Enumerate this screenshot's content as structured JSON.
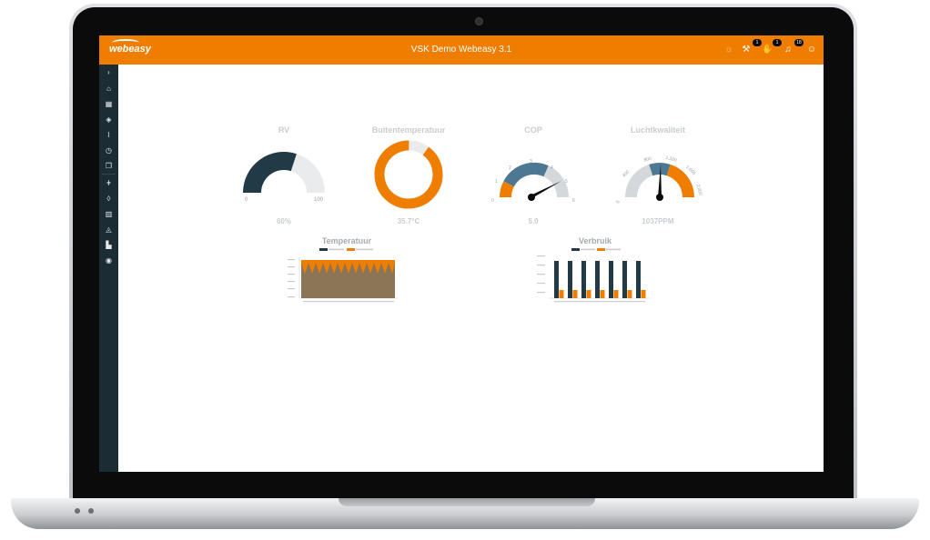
{
  "colors": {
    "accent": "#ef7d00",
    "dark": "#213a46",
    "sidebar": "#1b2c35",
    "track": "#e9ebec",
    "gaugeBlue": "#4d7894"
  },
  "header": {
    "logo": "webeasy",
    "title": "VSK Demo Webeasy 3.1",
    "icons": [
      {
        "name": "sun-icon",
        "badge": ""
      },
      {
        "name": "wrench-icon",
        "badge": "1"
      },
      {
        "name": "hand-icon",
        "badge": "1"
      },
      {
        "name": "bell-icon",
        "badge": "18"
      },
      {
        "name": "user-icon",
        "badge": ""
      }
    ]
  },
  "sidebar": {
    "items": [
      "chevron-right-icon",
      "home-icon",
      "grid-icon",
      "shield-icon",
      "line-chart-icon",
      "clock-icon",
      "copy-icon",
      "thermometer-icon",
      "drop-icon",
      "building-icon",
      "speedometer-icon",
      "bar-chart-icon",
      "gauge-icon"
    ]
  },
  "tiles": [
    {
      "title": "RV",
      "value": "60%",
      "min": "0",
      "max": "100",
      "level": 0.6
    },
    {
      "title": "Buitentemperatuur",
      "value": "35.7°C",
      "level": 0.9
    },
    {
      "title": "COP",
      "value": "5.0",
      "ticks": [
        "0",
        "1",
        "2",
        "3",
        "4",
        "5",
        "6"
      ]
    },
    {
      "title": "Luchtkwaliteit",
      "value": "1037PPM",
      "ticks": [
        "0",
        "400",
        "800",
        "1,200",
        "1,600",
        "2,000"
      ]
    }
  ],
  "charts": {
    "temperatuur": {
      "title": "Temperatuur"
    },
    "verbruik": {
      "title": "Verbruik"
    }
  }
}
